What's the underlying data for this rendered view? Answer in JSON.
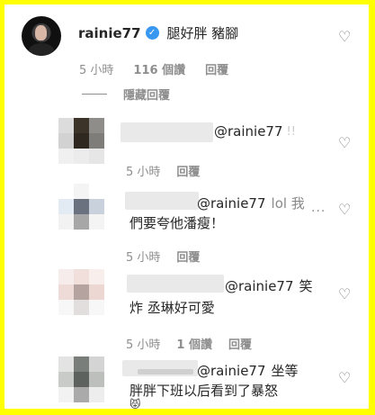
{
  "main_comment": {
    "username": "rainie77",
    "text": "腿好胖 豬腳",
    "time": "5 小時",
    "likes": "116 個讚",
    "reply": "回覆",
    "hide_replies": "隱藏回覆",
    "avatar_icon": "profile-photo"
  },
  "replies": [
    {
      "mention": "@rainie77",
      "trail": "!!",
      "line2": "",
      "time": "",
      "likes": "",
      "reply": "",
      "mosaic": [
        "#dcdcdc",
        "#3c3428",
        "#8f8d89",
        "#d2d2d2",
        "#2e2820",
        "#7f7d79",
        "#f0f0f0",
        "#ececec",
        "#e6e6e6"
      ]
    },
    {
      "mention": "@rainie77",
      "trail": "lol 我",
      "line2": "們要夸他潘瘦！",
      "time": "5 小時",
      "likes": "",
      "reply": "回覆",
      "more_icon": "more-options-icon",
      "mosaic": [
        "#ffffff",
        "#f4f4f4",
        "#ffffff",
        "#e2eaf3",
        "#6a7280",
        "#c9d2dc",
        "#f2f2f2",
        "#a7a7a7",
        "#f4f4f4"
      ]
    },
    {
      "mention": "@rainie77",
      "trail": "笑",
      "line2": "炸 丞琳好可愛",
      "time": "5 小時",
      "likes": "",
      "reply": "回覆",
      "mosaic": [
        "#f6eceb",
        "#f1dfdc",
        "#f8efed",
        "#eedbd8",
        "#b4a39f",
        "#ecd7d3",
        "#f7f7f7",
        "#e2dedd",
        "#f7f7f7"
      ]
    },
    {
      "mention": "@rainie77",
      "trail": "坐等",
      "line2": "胖胖下班以后看到了暴怒",
      "time": "5 小時",
      "likes": "1 個讚",
      "reply": "回覆",
      "mosaic": [
        "#e3e3e3",
        "#7a7e7a",
        "#d4d4d4",
        "#c8cbc8",
        "#5e625e",
        "#bdbfbd",
        "#f2f2f2",
        "#a9aaa9",
        "#ededed"
      ]
    }
  ],
  "colors": {
    "border": "#ffff00",
    "verified": "#3897f0",
    "meta": "#8e8e8e",
    "text": "#262626"
  },
  "icons": {
    "heart": "heart-outline-icon",
    "verified": "verified-badge-icon"
  }
}
